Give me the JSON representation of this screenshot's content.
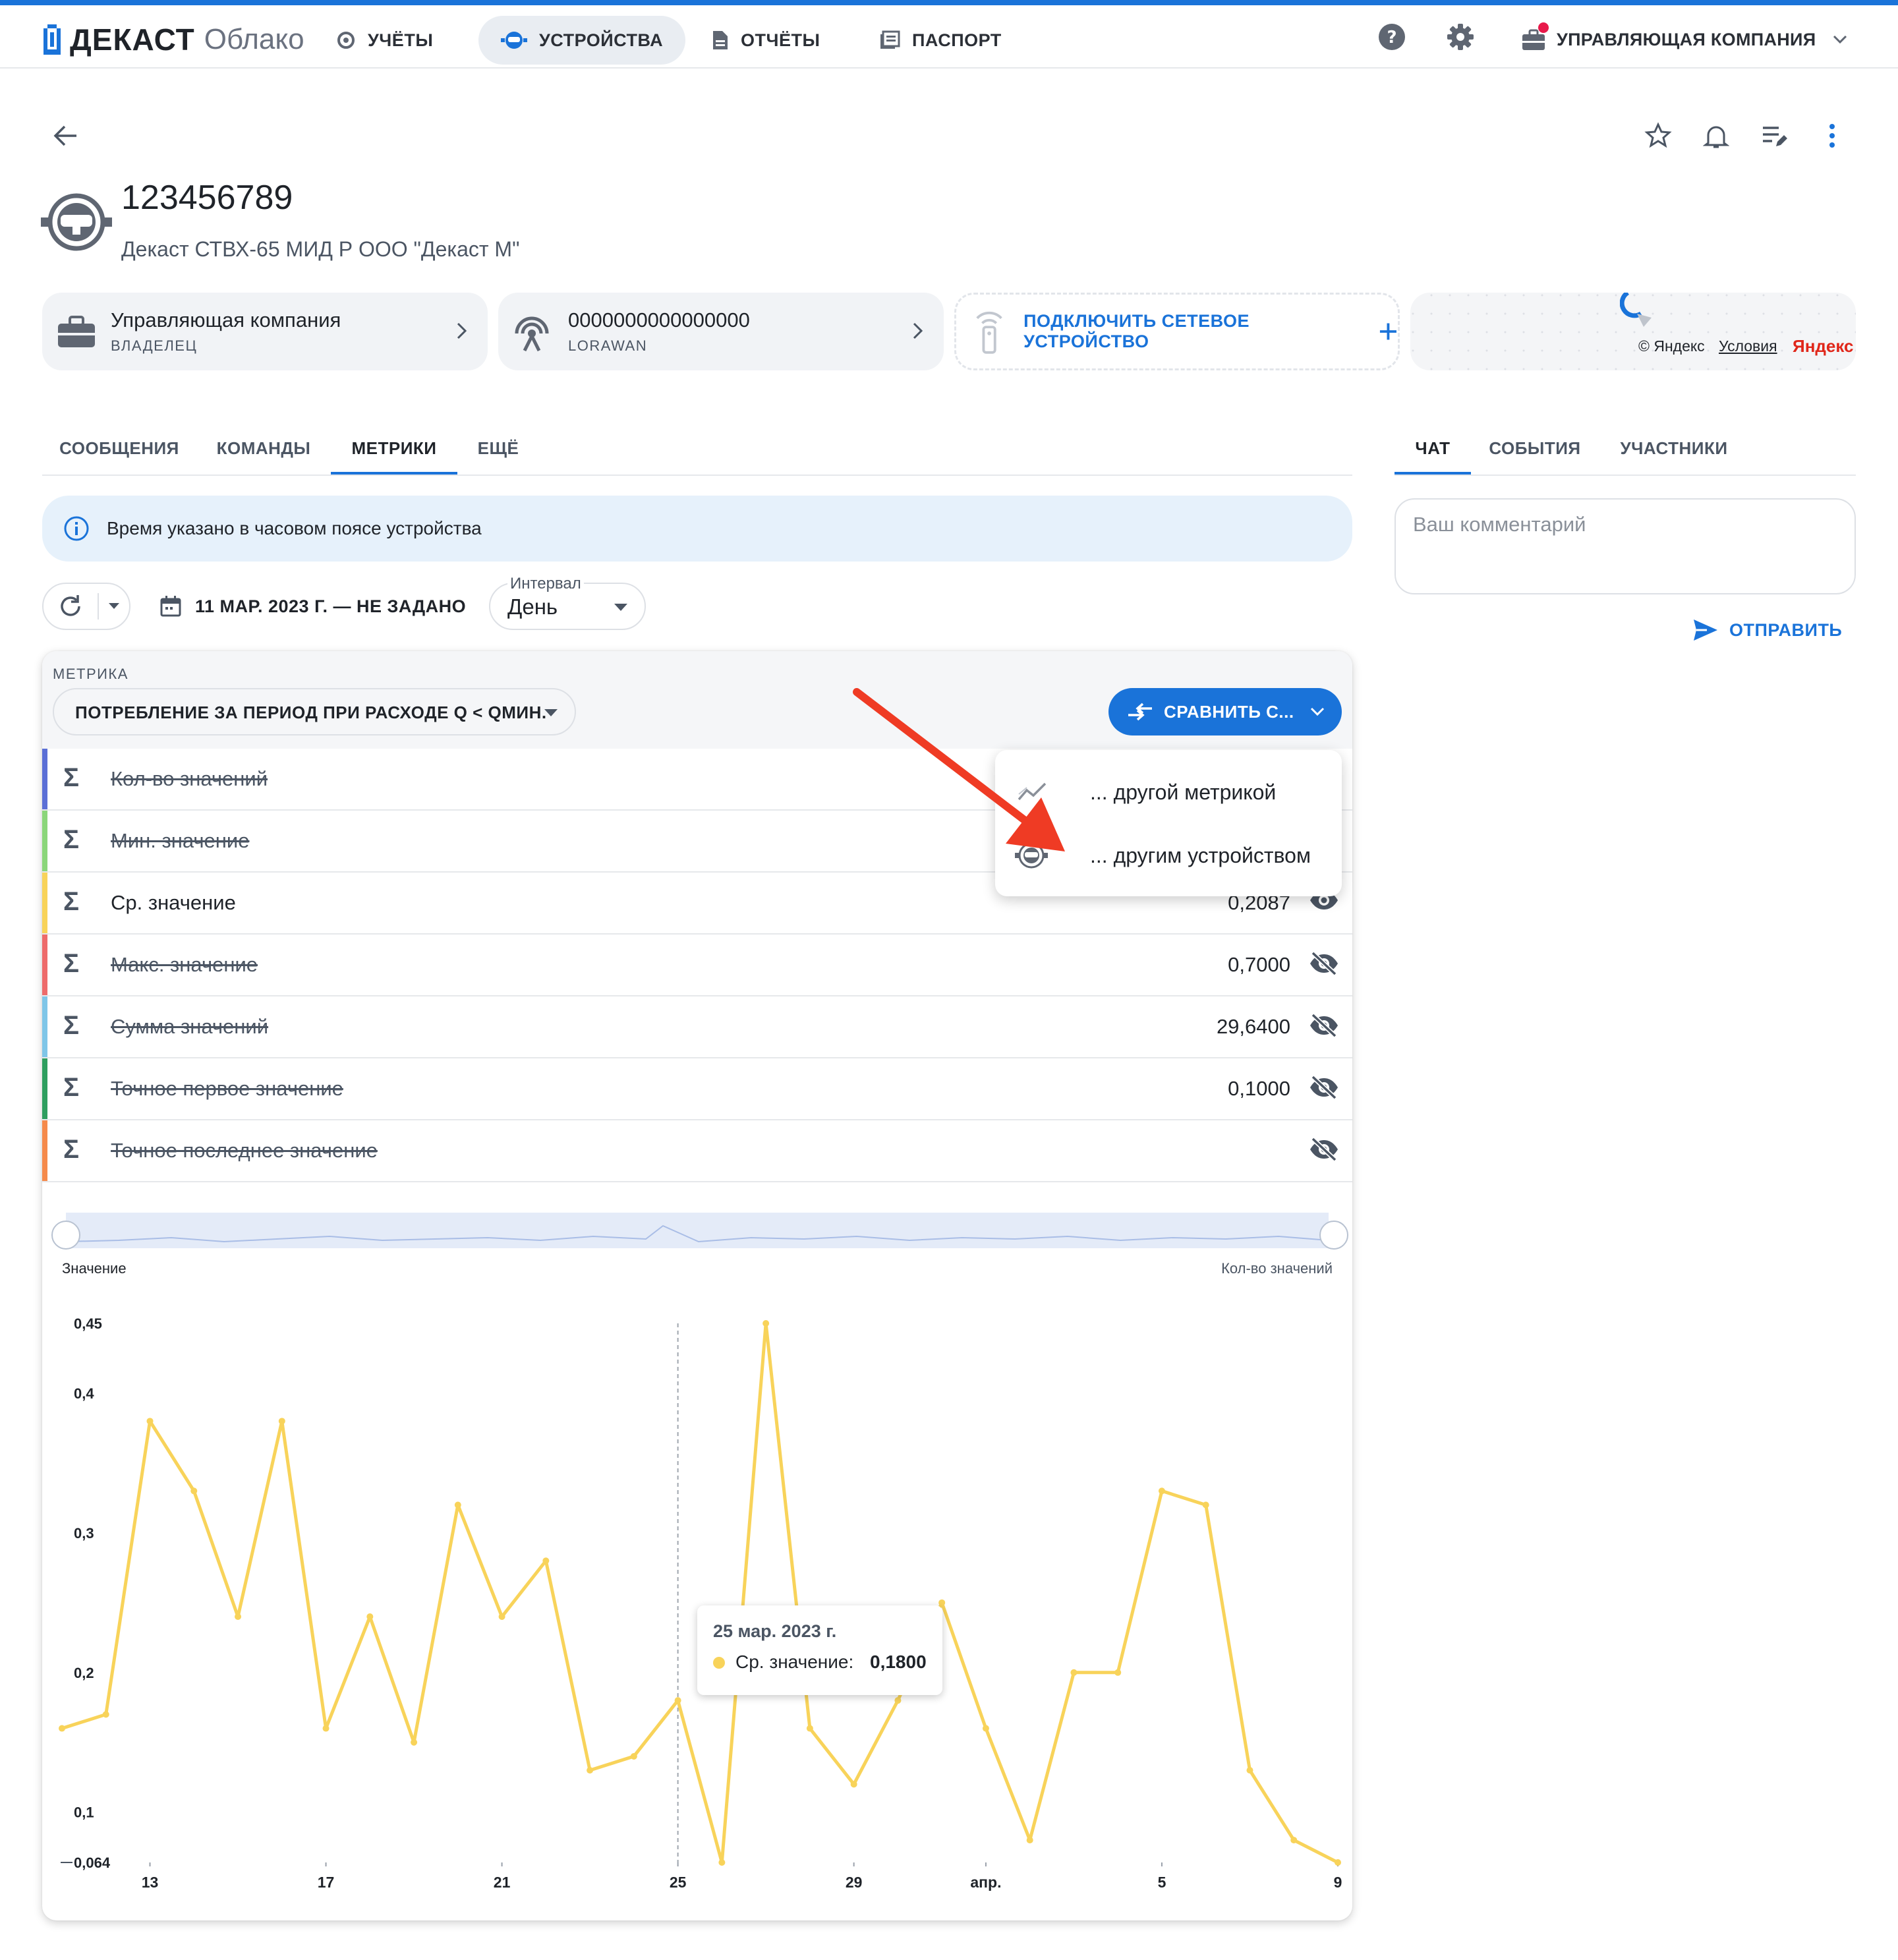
{
  "app": {
    "logo": {
      "brand": "ДЕКАСТ",
      "product": "Облако"
    },
    "nav": [
      {
        "label": "УЧЁТЫ",
        "active": false,
        "icon": "gauge-icon"
      },
      {
        "label": "УСТРОЙСТВА",
        "active": true,
        "icon": "meter-icon"
      },
      {
        "label": "ОТЧЁТЫ",
        "active": false,
        "icon": "document-icon"
      },
      {
        "label": "ПАСПОРТ",
        "active": false,
        "icon": "passport-icon"
      }
    ],
    "account": {
      "label": "УПРАВЛЯЮЩАЯ КОМПАНИЯ",
      "notification_color": "#e8194a"
    },
    "accent_color": "#1a73d9"
  },
  "device": {
    "number": "123456789",
    "model": "Декаст СТВХ-65 МИД Р ООО \"Декаст М\""
  },
  "cards": {
    "owner": {
      "title": "Управляющая компания",
      "subtitle": "ВЛАДЕЛЕЦ"
    },
    "network": {
      "title": "0000000000000000",
      "subtitle": "LORAWAN"
    },
    "connect": {
      "label": "ПОДКЛЮЧИТЬ СЕТЕВОЕ УСТРОЙСТВО"
    },
    "map": {
      "copyright": "© Яндекс",
      "terms": "Условия",
      "provider": "Яндекс"
    }
  },
  "tabs": [
    {
      "label": "СООБЩЕНИЯ",
      "active": false
    },
    {
      "label": "КОМАНДЫ",
      "active": false
    },
    {
      "label": "МЕТРИКИ",
      "active": true
    },
    {
      "label": "ЕЩЁ",
      "active": false
    }
  ],
  "side_tabs": [
    {
      "label": "ЧАТ",
      "active": true
    },
    {
      "label": "СОБЫТИЯ",
      "active": false
    },
    {
      "label": "УЧАСТНИКИ",
      "active": false
    }
  ],
  "chat": {
    "placeholder": "Ваш комментарий",
    "send_label": "ОТПРАВИТЬ"
  },
  "info_banner": "Время указано в часовом поясе устройства",
  "controls": {
    "date_range": "11 МАР. 2023 Г. — НЕ ЗАДАНО",
    "interval_label": "Интервал",
    "interval_value": "День"
  },
  "metric": {
    "label": "МЕТРИКА",
    "value": "ПОТРЕБЛЕНИЕ ЗА ПЕРИОД ПРИ РАСХОДЕ Q < QМИН.",
    "compare_button": "СРАВНИТЬ С..."
  },
  "compare_menu": [
    "... другой метрикой",
    "... другим устройством"
  ],
  "stats": [
    {
      "name": "Кол-во значений",
      "value": "",
      "visible": false,
      "color": "#5b6fd6"
    },
    {
      "name": "Мин. значение",
      "value": "",
      "visible": false,
      "color": "#8bd67a"
    },
    {
      "name": "Ср. значение",
      "value": "0,2087",
      "visible": true,
      "color": "#f8d35a"
    },
    {
      "name": "Макс. значение",
      "value": "0,7000",
      "visible": false,
      "color": "#ee6b6b"
    },
    {
      "name": "Сумма значений",
      "value": "29,6400",
      "visible": false,
      "color": "#7fc6e8"
    },
    {
      "name": "Точное первое значение",
      "value": "0,1000",
      "visible": false,
      "color": "#2e9e5f"
    },
    {
      "name": "Точное последнее значение",
      "value": "",
      "visible": false,
      "color": "#f58a4b"
    }
  ],
  "chart_data": {
    "type": "line",
    "ylabel": "Значение",
    "y2label": "Кол-во значений",
    "y_ticks": [
      "0,45",
      "0,4",
      "0,3",
      "0,2",
      "0,1",
      "0,064"
    ],
    "x_ticks": [
      "13",
      "17",
      "21",
      "25",
      "29",
      "апр.",
      "5",
      "9"
    ],
    "ylim": [
      0.064,
      0.45
    ],
    "series": [
      {
        "name": "Ср. значение",
        "color": "#f8d35a",
        "x": [
          "2023-03-11",
          "2023-03-12",
          "2023-03-13",
          "2023-03-14",
          "2023-03-15",
          "2023-03-16",
          "2023-03-17",
          "2023-03-18",
          "2023-03-19",
          "2023-03-20",
          "2023-03-21",
          "2023-03-22",
          "2023-03-23",
          "2023-03-24",
          "2023-03-25",
          "2023-03-26",
          "2023-03-27",
          "2023-03-28",
          "2023-03-29",
          "2023-03-30",
          "2023-03-31",
          "2023-04-01",
          "2023-04-02",
          "2023-04-03",
          "2023-04-04",
          "2023-04-05",
          "2023-04-06",
          "2023-04-07",
          "2023-04-08",
          "2023-04-09"
        ],
        "values": [
          0.16,
          0.17,
          0.38,
          0.33,
          0.24,
          0.38,
          0.16,
          0.24,
          0.15,
          0.32,
          0.24,
          0.28,
          0.13,
          0.14,
          0.18,
          0.064,
          0.45,
          0.16,
          0.12,
          0.18,
          0.25,
          0.16,
          0.08,
          0.2,
          0.2,
          0.33,
          0.32,
          0.13,
          0.08,
          0.064
        ]
      }
    ],
    "tooltip": {
      "date": "25 мар. 2023 г.",
      "label": "Ср. значение:",
      "value": "0,1800"
    }
  }
}
